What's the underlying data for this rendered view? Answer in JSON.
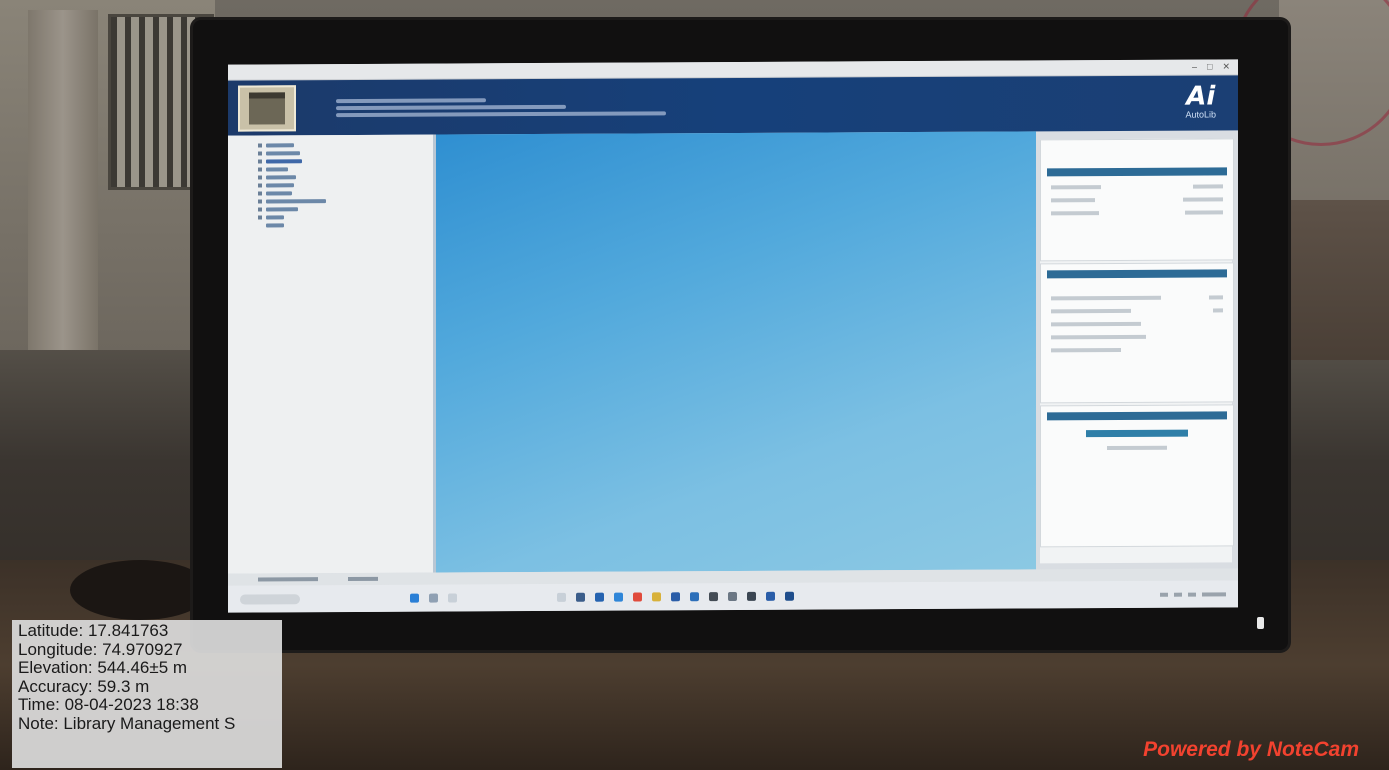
{
  "geotag": {
    "latitude": "Latitude: 17.841763",
    "longitude": "Longitude: 74.970927",
    "elevation": "Elevation: 544.46±5 m",
    "accuracy": "Accuracy: 59.3 m",
    "time": "Time: 08-04-2023 18:38",
    "note": "Note: Library Management S"
  },
  "watermark": "Powered by NoteCam",
  "app": {
    "brand_mark": "Ai",
    "brand_name": "AutoLib"
  },
  "colors": {
    "header_blue": "#1c3a6a",
    "canvas_blue": "#52a9dc",
    "watermark_red": "#f2422f"
  },
  "icons": [
    "windows-start-icon",
    "search-icon",
    "file-explorer-icon",
    "browser-icon",
    "mail-icon",
    "store-icon"
  ]
}
